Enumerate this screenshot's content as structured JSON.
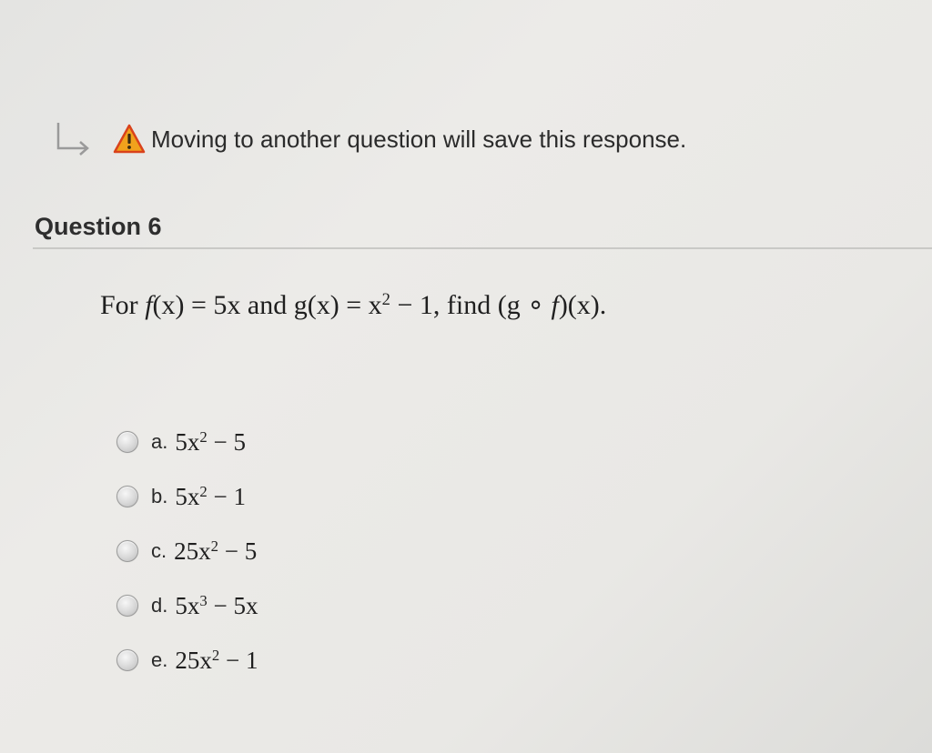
{
  "notice": {
    "text": "Moving to another question will save this response.",
    "return_icon": "return-arrow-icon",
    "warning_icon": "warning-triangle-icon"
  },
  "question": {
    "title": "Question 6",
    "prompt": {
      "intro": "For ",
      "f_name": "f",
      "f_def": "(x) = 5x and g(x) = x",
      "f_exp": "2",
      "tail": " − 1, find (g ∘ ",
      "f_name2": "f",
      "end": ")(x)."
    }
  },
  "options": [
    {
      "letter": "a.",
      "base": "5x",
      "exp": "2",
      "rest": " − 5"
    },
    {
      "letter": "b.",
      "base": "5x",
      "exp": "2",
      "rest": " − 1"
    },
    {
      "letter": "c.",
      "base": "25x",
      "exp": "2",
      "rest": " − 5"
    },
    {
      "letter": "d.",
      "base": "5x",
      "exp": "3",
      "rest": " − 5x"
    },
    {
      "letter": "e.",
      "base": "25x",
      "exp": "2",
      "rest": " − 1"
    }
  ],
  "colors": {
    "warning_fill": "#f1a21c",
    "warning_outline": "#d9421b",
    "radio": "#d0d0d0"
  }
}
